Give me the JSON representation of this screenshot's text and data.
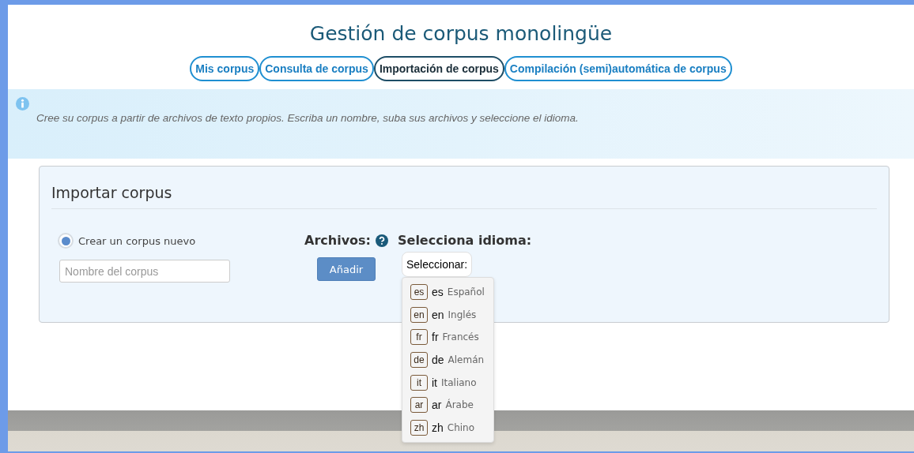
{
  "title": "Gestión de corpus monolingüe",
  "tabs": [
    {
      "label": "Mis corpus",
      "selected": false
    },
    {
      "label": "Consulta de corpus",
      "selected": false
    },
    {
      "label": "Importación de corpus",
      "selected": true
    },
    {
      "label": "Compilación (semi)automática de corpus",
      "selected": false
    }
  ],
  "info": {
    "text": "Cree su corpus a partir de archivos de texto propios. Escriba un nombre, suba sus archivos y seleccione el idioma."
  },
  "panel": {
    "title": "Importar corpus",
    "radio": {
      "label": "Crear un corpus nuevo",
      "selected": true
    },
    "name_field": {
      "placeholder": "Nombre del corpus"
    },
    "files": {
      "label": "Archivos:",
      "button": "Añadir"
    },
    "language": {
      "label": "Selecciona idioma:",
      "select": "Seleccionar:",
      "expanded": true,
      "options": [
        {
          "badge": "es",
          "code": "es",
          "name": "Español"
        },
        {
          "badge": "en",
          "code": "en",
          "name": "Inglés"
        },
        {
          "badge": "fr",
          "code": "fr",
          "name": "Francés"
        },
        {
          "badge": "de",
          "code": "de",
          "name": "Alemán"
        },
        {
          "badge": "it",
          "code": "it",
          "name": "Italiano"
        },
        {
          "badge": "ar",
          "code": "ar",
          "name": "Árabe"
        },
        {
          "badge": "zh",
          "code": "zh",
          "name": "Chino"
        }
      ]
    }
  }
}
